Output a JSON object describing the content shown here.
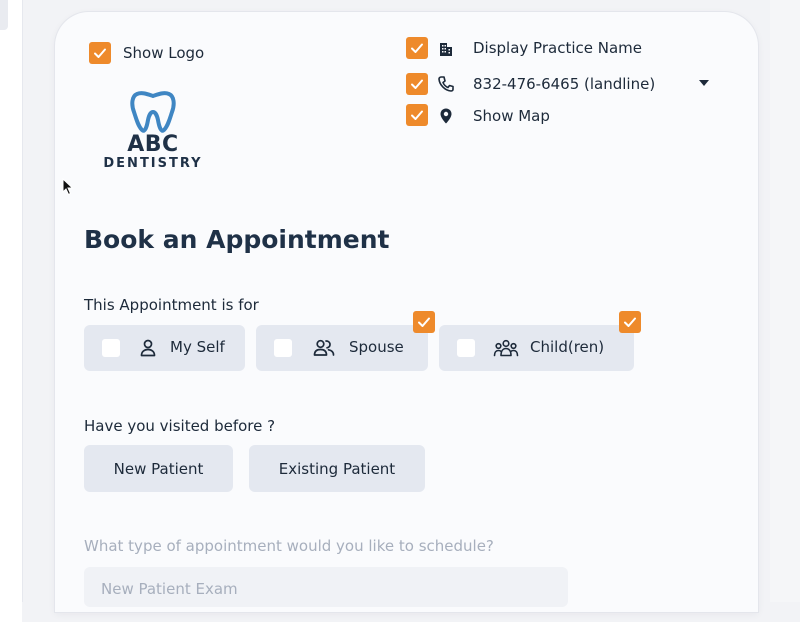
{
  "colors": {
    "accent": "#ee8a2b",
    "option_bg": "#e4e8f0",
    "heading": "#1f3147",
    "muted": "#a7afbd"
  },
  "top_left": {
    "show_logo": {
      "label": "Show Logo",
      "checked": true
    }
  },
  "logo": {
    "line1": "ABC",
    "line2": "DENTISTRY",
    "icon": "tooth-icon"
  },
  "top_right": {
    "practice_name": {
      "label": "Display Practice Name",
      "checked": true,
      "icon": "building-icon"
    },
    "phone": {
      "label": "832-476-6465 (landline)",
      "checked": true,
      "icon": "phone-icon"
    },
    "map": {
      "label": "Show Map",
      "checked": true,
      "icon": "map-pin-icon"
    }
  },
  "form": {
    "title": "Book an Appointment",
    "for_label": "This Appointment is for",
    "for_options": [
      {
        "label": "My Self",
        "icon": "person-icon",
        "enabled": false
      },
      {
        "label": "Spouse",
        "icon": "two-people-icon",
        "enabled": true
      },
      {
        "label": "Child(ren)",
        "icon": "family-icon",
        "enabled": true
      }
    ],
    "visited_label": "Have you visited before ?",
    "visited_options": [
      {
        "label": "New Patient"
      },
      {
        "label": "Existing Patient"
      }
    ],
    "type_label": "What type of appointment would you like to schedule?",
    "type_placeholder": "New Patient Exam"
  }
}
